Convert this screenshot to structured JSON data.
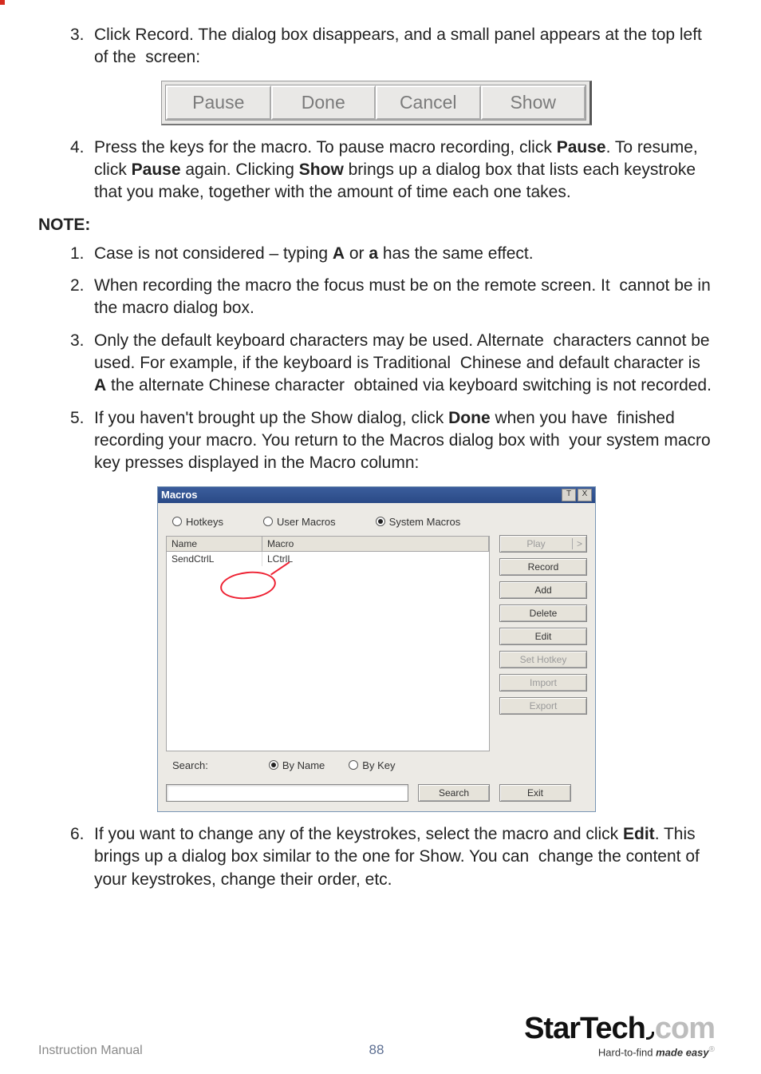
{
  "step3": {
    "num": "3.",
    "text": "Click Record. The dialog box disappears, and a small panel appears at the top left of the  screen:"
  },
  "rec_panel": {
    "pause": "Pause",
    "done": "Done",
    "cancel": "Cancel",
    "show": "Show"
  },
  "step4": {
    "num": "4.",
    "t1": "Press the keys for the macro. To pause macro recording, click ",
    "b1": "Pause",
    "t2": ". To resume, click ",
    "b2": "Pause",
    "t3": " again. Clicking ",
    "b3": "Show",
    "t4": " brings up a dialog box that lists each keystroke that you make, together with the amount of time each one takes."
  },
  "note_label": "NOTE:",
  "note1": {
    "num": "1.",
    "t1": "Case is not considered – typing ",
    "b1": "A",
    "t2": " or ",
    "b2": "a",
    "t3": " has the same effect."
  },
  "note2": {
    "num": "2.",
    "text": "When recording the macro the focus must be on the remote screen. It  cannot be in the macro dialog box."
  },
  "note3": {
    "num": "3.",
    "t1": "Only the default keyboard characters may be used. Alternate  characters cannot be used. For example, if the keyboard is Traditional  Chinese and default character is ",
    "b1": "A",
    "t2": " the alternate Chinese character  obtained via keyboard switching is not recorded."
  },
  "step5": {
    "num": "5.",
    "t1": "If you haven't brought up the Show dialog, click ",
    "b1": "Done",
    "t2": " when you have  finished recording your macro. You return to the Macros dialog box with  your system macro key presses displayed in the Macro column:"
  },
  "dialog": {
    "title": "Macros",
    "pin": "T",
    "close": "X",
    "radios_top": {
      "hotkeys": "Hotkeys",
      "user": "User Macros",
      "system": "System Macros"
    },
    "cols": {
      "name": "Name",
      "macro": "Macro"
    },
    "row1": {
      "name": "SendCtrlL",
      "macro": "LCtrlL"
    },
    "buttons": {
      "play": "Play",
      "play_chev": ">",
      "record": "Record",
      "add": "Add",
      "delete": "Delete",
      "edit": "Edit",
      "sethotkey": "Set Hotkey",
      "import": "Import",
      "export": "Export"
    },
    "search_label": "Search:",
    "search_radios": {
      "byname": "By Name",
      "bykey": "By Key"
    },
    "search_btn": "Search",
    "exit_btn": "Exit"
  },
  "step6": {
    "num": "6.",
    "t1": "If you want to change any of the keystrokes, select the macro and click ",
    "b1": "Edit",
    "t2": ". This brings up a dialog box similar to the one for Show. You can  change the content of your keystrokes, change their order, etc."
  },
  "footer": {
    "instruction": "Instruction Manual",
    "page": "88",
    "logo_black": "StarTech",
    "logo_grey": "com",
    "tag1": "Hard-to-find ",
    "tag2": "made easy",
    "reg": "®"
  }
}
